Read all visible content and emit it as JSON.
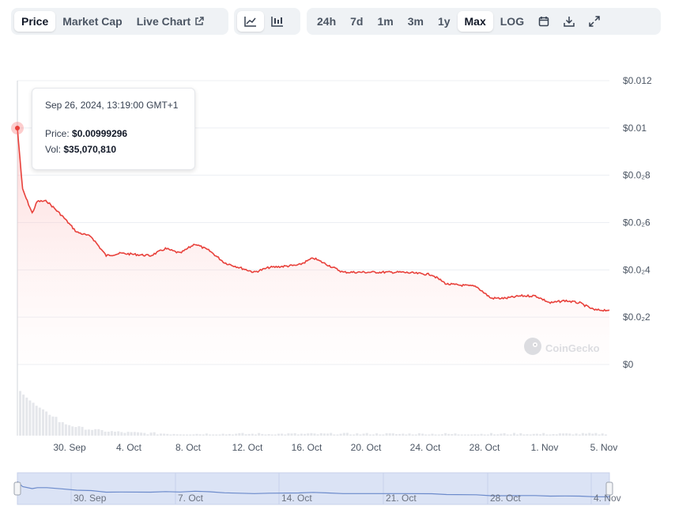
{
  "toolbar": {
    "type_tabs": [
      {
        "label": "Price",
        "active": true
      },
      {
        "label": "Market Cap",
        "active": false
      },
      {
        "label": "Live Chart",
        "active": false
      }
    ],
    "view_icons": [
      "line-chart-icon",
      "candlestick-icon"
    ],
    "range_tabs": [
      {
        "label": "24h",
        "active": false
      },
      {
        "label": "7d",
        "active": false
      },
      {
        "label": "1m",
        "active": false
      },
      {
        "label": "3m",
        "active": false
      },
      {
        "label": "1y",
        "active": false
      },
      {
        "label": "Max",
        "active": true
      },
      {
        "label": "LOG",
        "active": false
      }
    ],
    "action_icons": [
      "calendar-icon",
      "download-icon",
      "expand-icon"
    ]
  },
  "tooltip": {
    "date": "Sep 26, 2024, 13:19:00 GMT+1",
    "price_label": "Price:",
    "price_value": "$0.00999296",
    "vol_label": "Vol:",
    "vol_value": "$35,070,810"
  },
  "watermark": "CoinGecko",
  "colors": {
    "line": "#e8413b",
    "fill": "#fde2e1",
    "volume": "#e5e7eb",
    "navigator": "#dbe3f5"
  },
  "chart_data": {
    "type": "line",
    "title": "",
    "xlabel": "",
    "ylabel": "",
    "y_tick_labels": [
      "$0.012",
      "$0.01",
      "$0.0₂8",
      "$0.0₂6",
      "$0.0₂4",
      "$0.0₂2",
      "$0"
    ],
    "y_ticks": [
      0.012,
      0.01,
      0.008,
      0.006,
      0.004,
      0.002,
      0
    ],
    "ylim": [
      0,
      0.012
    ],
    "x_ticks": [
      "30. Sep",
      "4. Oct",
      "8. Oct",
      "12. Oct",
      "16. Oct",
      "20. Oct",
      "24. Oct",
      "28. Oct",
      "1. Nov",
      "5. Nov"
    ],
    "navigator_ticks": [
      "30. Sep",
      "7. Oct",
      "14. Oct",
      "21. Oct",
      "28. Oct",
      "4. Nov"
    ],
    "x_range": [
      "2024-09-26",
      "2024-11-05"
    ],
    "series": [
      {
        "values": [
          {
            "x": "2024-09-26",
            "y": 0.00999
          },
          {
            "x": "2024-09-26",
            "y": 0.0074
          },
          {
            "x": "2024-09-27",
            "y": 0.0064
          },
          {
            "x": "2024-09-27",
            "y": 0.0069
          },
          {
            "x": "2024-09-28",
            "y": 0.0069
          },
          {
            "x": "2024-09-29",
            "y": 0.0063
          },
          {
            "x": "2024-09-30",
            "y": 0.0056
          },
          {
            "x": "2024-10-01",
            "y": 0.0054
          },
          {
            "x": "2024-10-02",
            "y": 0.0046
          },
          {
            "x": "2024-10-03",
            "y": 0.0047
          },
          {
            "x": "2024-10-05",
            "y": 0.0046
          },
          {
            "x": "2024-10-06",
            "y": 0.0049
          },
          {
            "x": "2024-10-07",
            "y": 0.0047
          },
          {
            "x": "2024-10-08",
            "y": 0.0051
          },
          {
            "x": "2024-10-09",
            "y": 0.0048
          },
          {
            "x": "2024-10-10",
            "y": 0.0043
          },
          {
            "x": "2024-10-12",
            "y": 0.0039
          },
          {
            "x": "2024-10-13",
            "y": 0.0041
          },
          {
            "x": "2024-10-15",
            "y": 0.0042
          },
          {
            "x": "2024-10-16",
            "y": 0.0045
          },
          {
            "x": "2024-10-17",
            "y": 0.0042
          },
          {
            "x": "2024-10-18",
            "y": 0.0039
          },
          {
            "x": "2024-10-20",
            "y": 0.0039
          },
          {
            "x": "2024-10-22",
            "y": 0.0039
          },
          {
            "x": "2024-10-24",
            "y": 0.0038
          },
          {
            "x": "2024-10-25",
            "y": 0.0034
          },
          {
            "x": "2024-10-27",
            "y": 0.0033
          },
          {
            "x": "2024-10-28",
            "y": 0.0028
          },
          {
            "x": "2024-10-29",
            "y": 0.0028
          },
          {
            "x": "2024-10-30",
            "y": 0.0029
          },
          {
            "x": "2024-10-31",
            "y": 0.0029
          },
          {
            "x": "2024-11-01",
            "y": 0.0026
          },
          {
            "x": "2024-11-02",
            "y": 0.0027
          },
          {
            "x": "2024-11-03",
            "y": 0.0026
          },
          {
            "x": "2024-11-04",
            "y": 0.0023
          },
          {
            "x": "2024-11-05",
            "y": 0.0023
          }
        ]
      }
    ],
    "grid": true,
    "highlighted_point": {
      "x": "2024-09-26",
      "y": 0.00999296
    }
  }
}
